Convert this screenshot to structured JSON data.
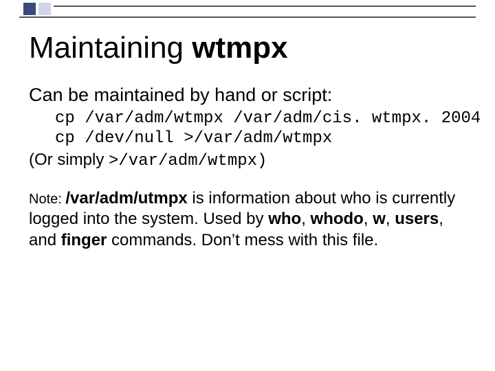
{
  "title": {
    "prefix": "Maintaining ",
    "bold": "wtmpx"
  },
  "subtitle": "Can be maintained by hand or script:",
  "code": {
    "line1": "cp /var/adm/wtmpx /var/adm/cis. wtmpx. 2004",
    "line2": "cp /dev/null >/var/adm/wtmpx"
  },
  "orline": {
    "prefix": "(Or simply ",
    "mono": ">/var/adm/wtmpx)"
  },
  "note": {
    "label": "Note: ",
    "path": "/var/adm/utmpx",
    "rest1": " is information about who is currently logged into the system. Used by ",
    "w1": "who",
    "c1": ", ",
    "w2": "whodo",
    "c2": ", ",
    "w3": "w",
    "c3": ", ",
    "w4": "users",
    "c4": ", and ",
    "w5": "finger",
    "rest2": " commands. Don’t mess with this file."
  }
}
